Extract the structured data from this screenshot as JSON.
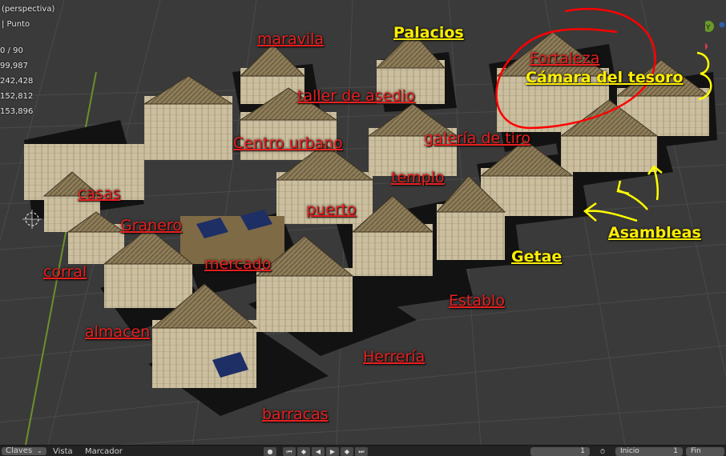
{
  "viewport": {
    "title": "(perspectiva)",
    "subtitle": "| Punto",
    "stats": [
      "0 / 90",
      "99,987",
      "242,428",
      "152,812",
      "153,896"
    ]
  },
  "labels": [
    {
      "text": "maravila",
      "color": "red"
    },
    {
      "text": "Palacios",
      "color": "yellow"
    },
    {
      "text": "Fortaleza",
      "color": "red"
    },
    {
      "text": "Cámara del tesoro",
      "color": "yellow"
    },
    {
      "text": "taller de asedio",
      "color": "red"
    },
    {
      "text": "Centro urbano",
      "color": "red"
    },
    {
      "text": "galería de tiro",
      "color": "red"
    },
    {
      "text": "templo",
      "color": "red"
    },
    {
      "text": "casas",
      "color": "red"
    },
    {
      "text": "puerto",
      "color": "red"
    },
    {
      "text": "Granero",
      "color": "red"
    },
    {
      "text": "Asambleas",
      "color": "yellow"
    },
    {
      "text": "mercado",
      "color": "red"
    },
    {
      "text": "Getae",
      "color": "yellow"
    },
    {
      "text": "corral",
      "color": "red"
    },
    {
      "text": "Establo",
      "color": "red"
    },
    {
      "text": "almacen",
      "color": "red"
    },
    {
      "text": "Herrería",
      "color": "red"
    },
    {
      "text": "barracas",
      "color": "red"
    }
  ],
  "timeline": {
    "menu": [
      "Claves",
      "Vista",
      "Marcador"
    ],
    "current_frame": "1",
    "start_label": "Inicio",
    "start_value": "1",
    "end_label": "Fin"
  },
  "colors": {
    "red_label": "#e82020",
    "yellow_label": "#ffef00",
    "grid_background": "#3a3a3a",
    "annotation_red": "#ff0000",
    "annotation_yellow": "#ffff00"
  }
}
